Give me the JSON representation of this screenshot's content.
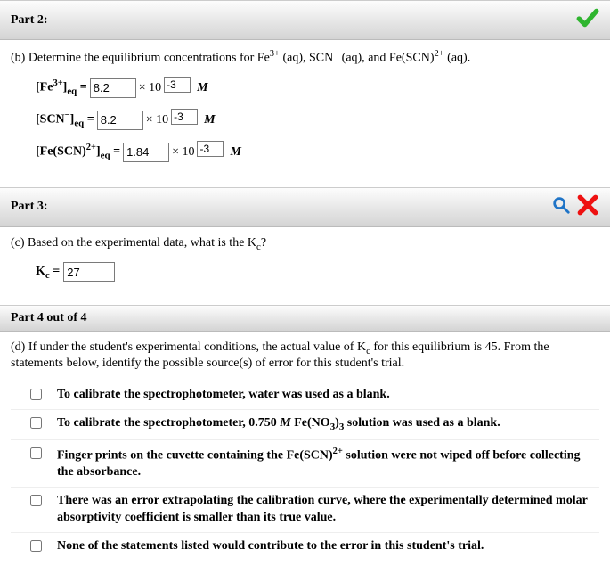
{
  "part2": {
    "title": "Part 2:",
    "question": "(b) Determine the equilibrium concentrations for Fe³⁺ (aq), SCN⁻ (aq), and Fe(SCN)²⁺ (aq).",
    "rows": [
      {
        "species_html": "[Fe<sup>3+</sup>]<sub>eq</sub> =",
        "value": "8.2",
        "exponent": "-3"
      },
      {
        "species_html": "[SCN<sup>−</sup>]<sub>eq</sub> =",
        "value": "8.2",
        "exponent": "-3"
      },
      {
        "species_html": "[Fe(SCN)<sup>2+</sup>]<sub>eq</sub> =",
        "value": "1.84",
        "exponent": "-3"
      }
    ],
    "times10": "× 10",
    "unit": "M"
  },
  "part3": {
    "title": "Part 3:",
    "question": "(c) Based on the experimental data, what is the Kc?",
    "kc_label_html": "K<sub>c</sub> =",
    "kc_value": "27"
  },
  "part4": {
    "title": "Part 4 out of 4",
    "question_html": "(d) If under the student's experimental conditions, the actual value of K<sub>c</sub> for this equilibrium is 45. From the statements below, identify the possible source(s) of error for this student's trial.",
    "choices": [
      "To calibrate the spectrophotometer, water was used as a blank.",
      "To calibrate the spectrophotometer, 0.750 <i>M</i> Fe(NO<sub>3</sub>)<sub>3</sub> solution was used as a blank.",
      "Finger prints on the cuvette containing the Fe(SCN)<sup>2+</sup> solution were not wiped off before collecting the absorbance.",
      "There was an error extrapolating the calibration curve, where the experimentally determined molar absorptivity coefficient is smaller than its true value.",
      "None of the statements listed would contribute to the error in this student's trial."
    ]
  }
}
